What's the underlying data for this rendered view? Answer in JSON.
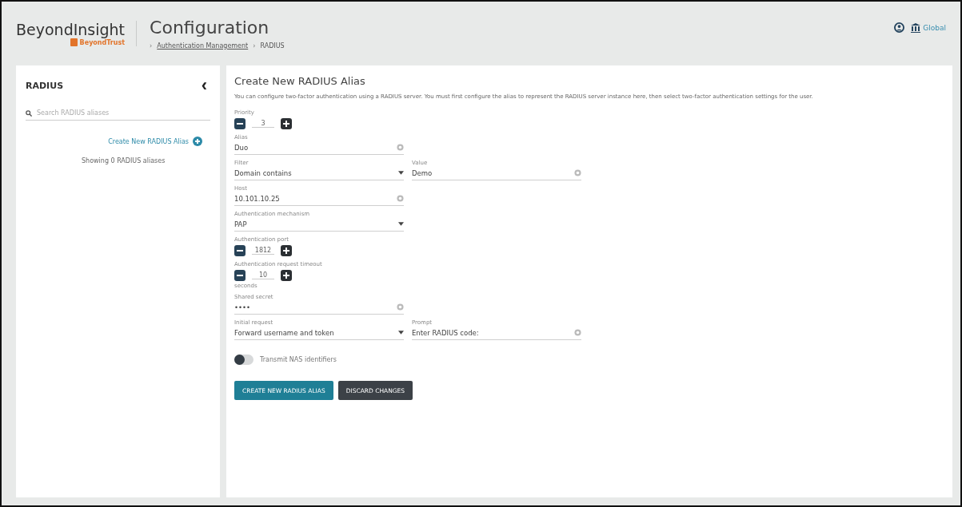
{
  "header": {
    "product": "BeyondInsight",
    "brand": "BeyondTrust",
    "page_title": "Configuration",
    "breadcrumbs": [
      {
        "separator": "›",
        "label": "Authentication Management",
        "link": true
      },
      {
        "separator": "›",
        "label": "RADIUS",
        "link": false
      }
    ],
    "scope": "Global"
  },
  "sidebar": {
    "title": "RADIUS",
    "collapse": "‹",
    "search": {
      "placeholder": "Search RADIUS aliases"
    },
    "create_link": "Create New RADIUS Alias",
    "count": "Showing 0 RADIUS aliases"
  },
  "form": {
    "title": "Create New RADIUS Alias",
    "description": "You can configure two-factor authentication using a RADIUS server. You must first configure the alias to represent the RADIUS server instance here, then select two-factor authentication settings for the user.",
    "rows": [
      {
        "fields": [
          {
            "kind": "stepper",
            "label": "Priority",
            "value": "3"
          }
        ]
      },
      {
        "fields": [
          {
            "kind": "text",
            "label": "Alias",
            "value": "Duo"
          }
        ]
      },
      {
        "fields": [
          {
            "kind": "select",
            "label": "Filter",
            "value": "Domain contains"
          },
          {
            "kind": "text",
            "label": "Value",
            "value": "Demo"
          }
        ]
      },
      {
        "fields": [
          {
            "kind": "text",
            "label": "Host",
            "value": "10.101.10.25"
          }
        ]
      },
      {
        "fields": [
          {
            "kind": "select",
            "label": "Authentication mechanism",
            "value": "PAP"
          }
        ]
      },
      {
        "fields": [
          {
            "kind": "stepper",
            "label": "Authentication port",
            "value": "1812"
          }
        ]
      },
      {
        "fields": [
          {
            "kind": "stepper",
            "label": "Authentication request timeout",
            "value": "10",
            "unit": "seconds"
          }
        ]
      },
      {
        "fields": [
          {
            "kind": "text",
            "label": "Shared secret",
            "value": "••••"
          }
        ]
      },
      {
        "fields": [
          {
            "kind": "select",
            "label": "Initial request",
            "value": "Forward username and token"
          },
          {
            "kind": "text",
            "label": "Prompt",
            "value": "Enter RADIUS code:"
          }
        ]
      }
    ],
    "toggle": {
      "label": "Transmit NAS identifiers",
      "on": false
    },
    "buttons": [
      {
        "label": "CREATE NEW RADIUS ALIAS",
        "kind": "primary"
      },
      {
        "label": "DISCARD CHANGES",
        "kind": "secondary"
      }
    ]
  }
}
